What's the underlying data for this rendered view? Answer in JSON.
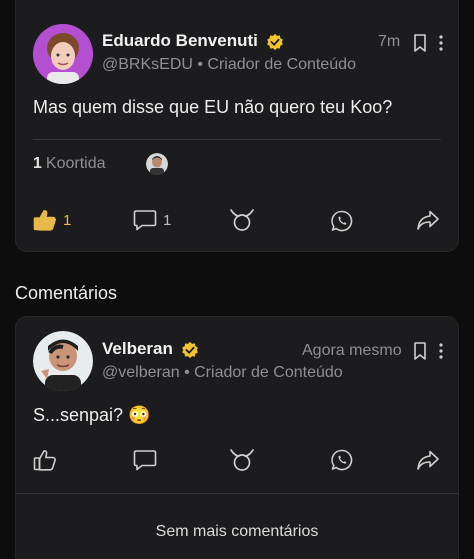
{
  "post": {
    "author_name": "Eduardo Benvenuti",
    "handle": "@BRKsEDU",
    "role": "Criador de Conteúdo",
    "time": "7m",
    "text": "Mas quem disse que EU não quero teu Koo?",
    "rekoo_count": "1",
    "rekoo_label": "Koortida",
    "likes": "1",
    "comments": "1"
  },
  "comments_section": {
    "title": "Comentários"
  },
  "comment": {
    "author_name": "Velberan",
    "handle": "@velberan",
    "role": "Criador de Conteúdo",
    "time": "Agora mesmo",
    "text": "S...senpai? 😳"
  },
  "footer": {
    "no_more_comments": "Sem mais comentários"
  },
  "icons": {
    "verified": "verified-badge-icon",
    "bookmark": "bookmark-icon",
    "more": "more-vertical-icon",
    "like": "thumbs-up-icon",
    "comment": "chat-bubble-icon",
    "rekoo": "rekoo-icon",
    "whatsapp": "whatsapp-icon",
    "share": "share-arrow-icon"
  },
  "colors": {
    "background": "#0d0d0d",
    "card": "#1c1c1e",
    "accent_like": "#e8b84a",
    "verified": "#f4c430",
    "muted_text": "#8f8f94"
  }
}
